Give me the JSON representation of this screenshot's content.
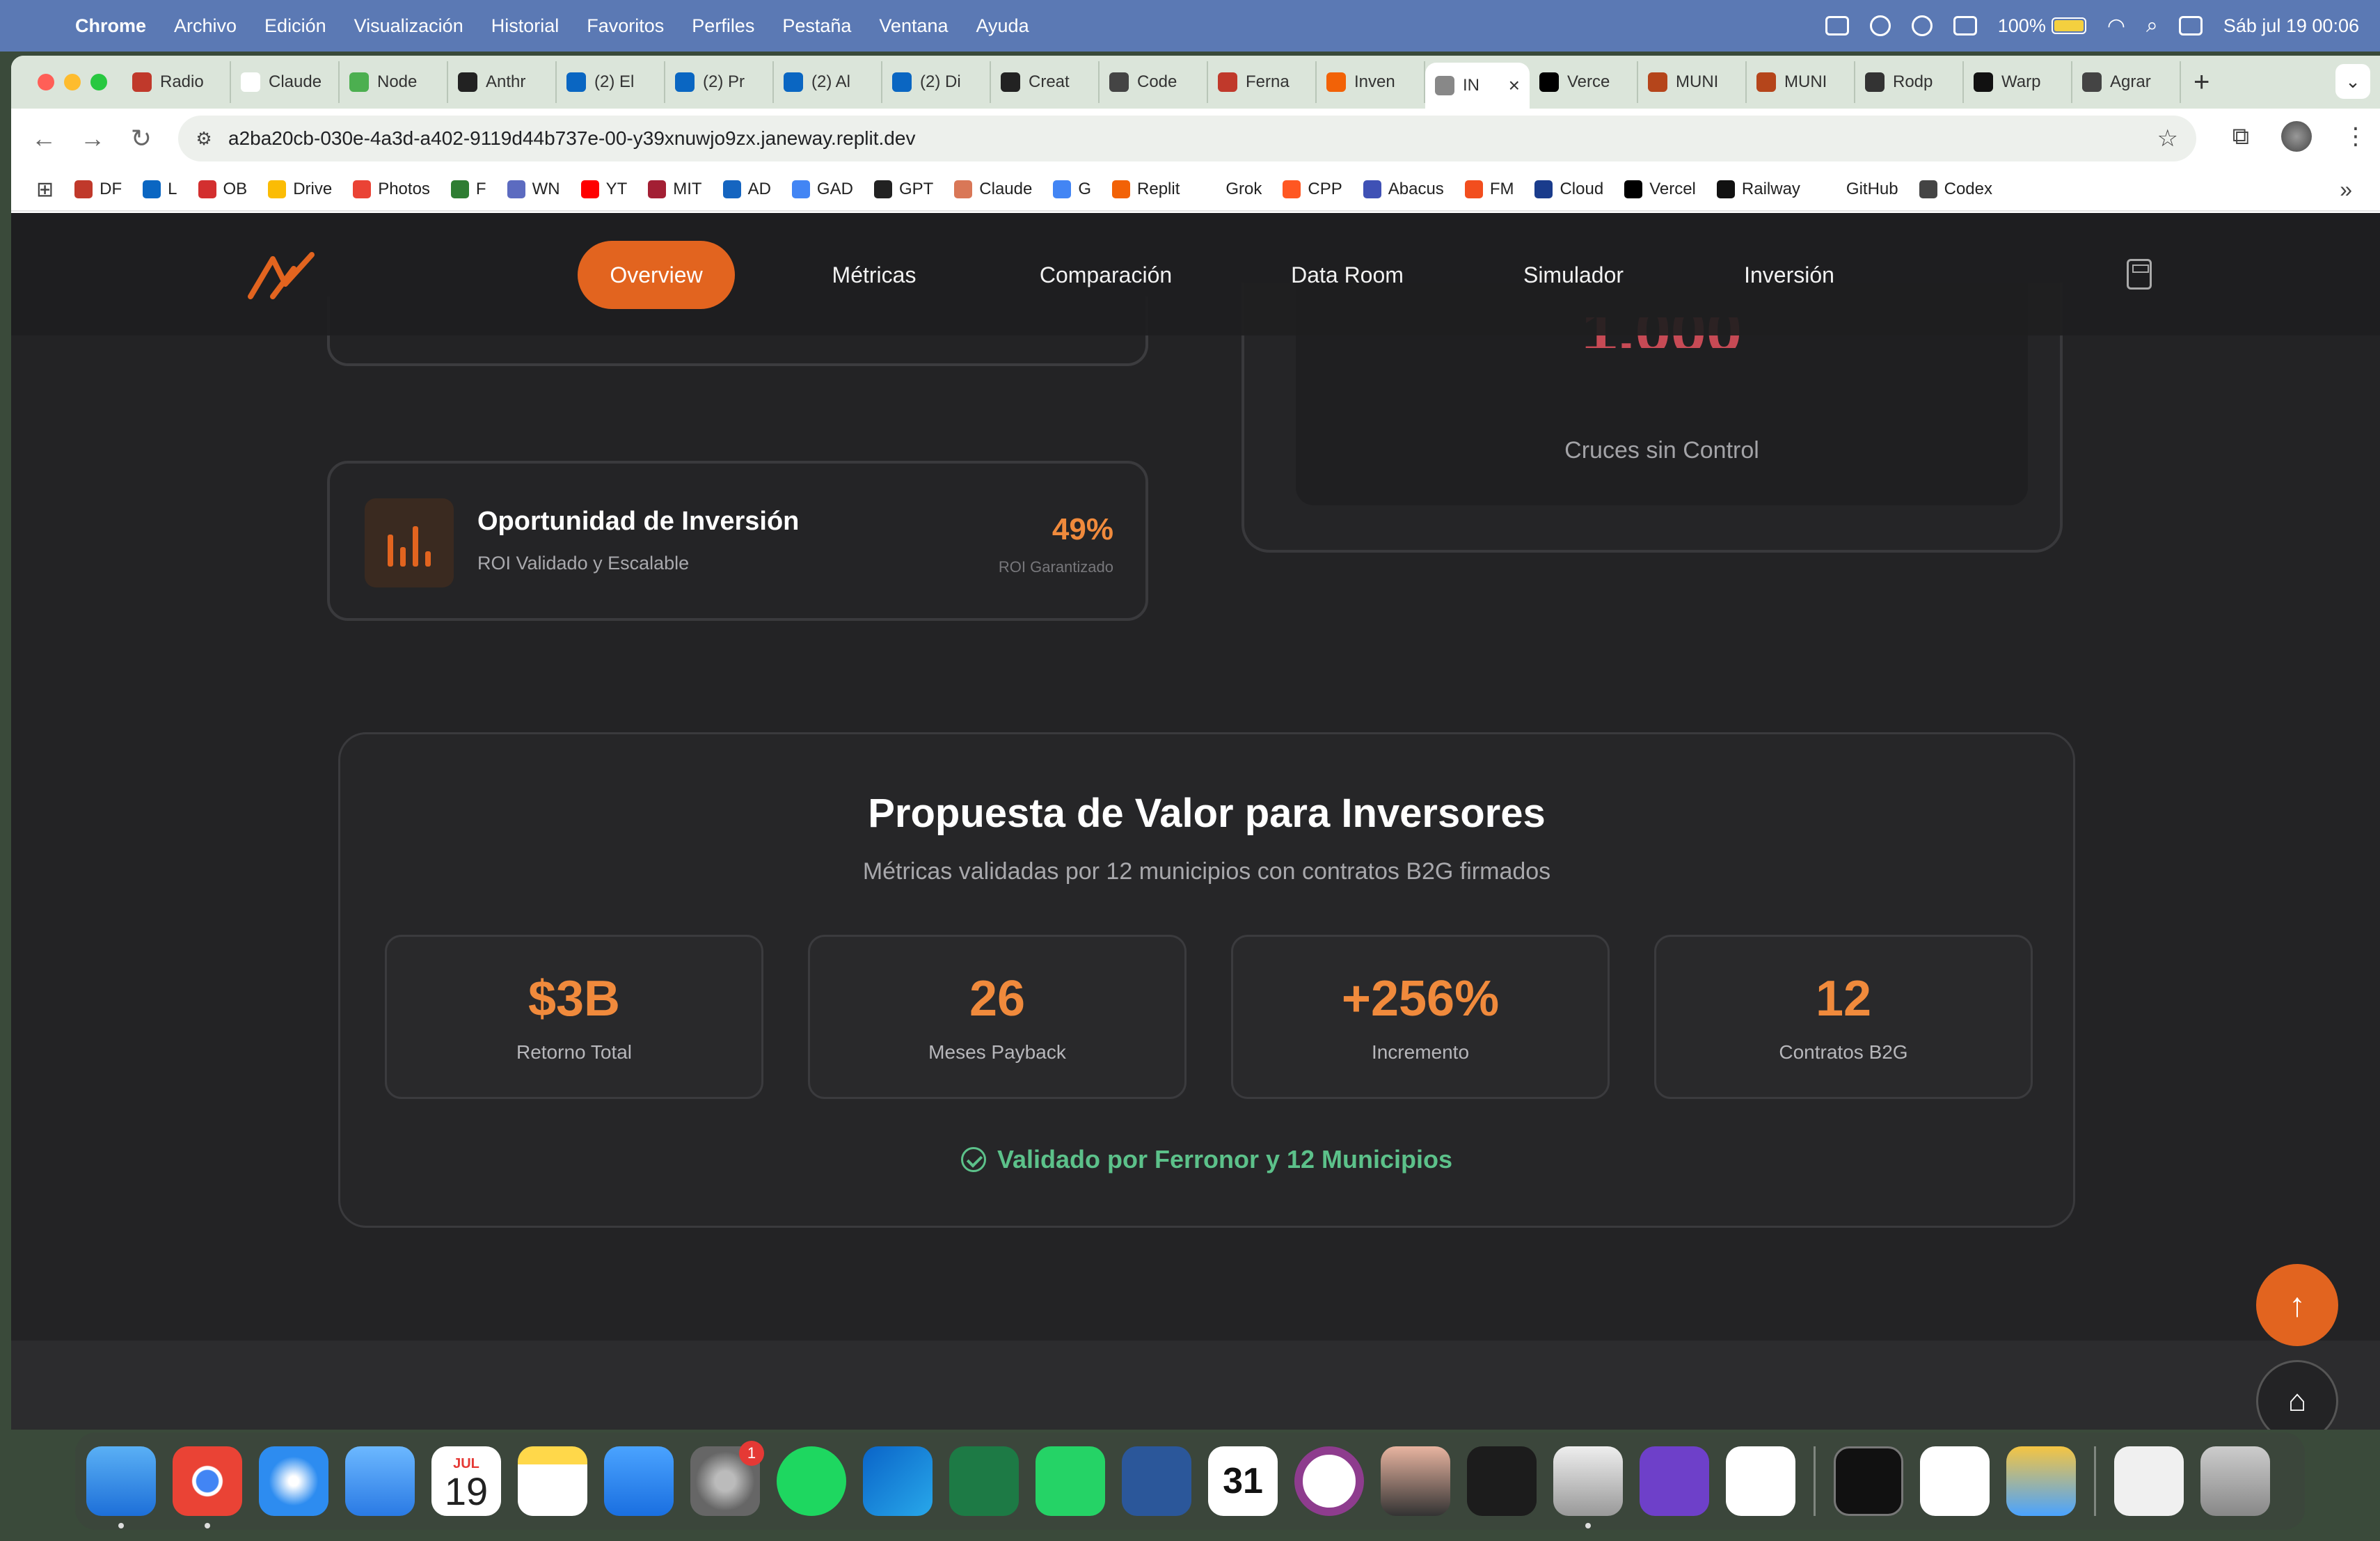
{
  "menubar": {
    "app": "Chrome",
    "items": [
      "Archivo",
      "Edición",
      "Visualización",
      "Historial",
      "Favoritos",
      "Perfiles",
      "Pestaña",
      "Ventana",
      "Ayuda"
    ],
    "battery": "100%",
    "datetime": "Sáb jul 19  00:06"
  },
  "tabs": [
    {
      "label": "Radio",
      "color": "#c0392b"
    },
    {
      "label": "Claude",
      "color": "#ffffff"
    },
    {
      "label": "Node",
      "color": "#4caf50"
    },
    {
      "label": "Anthr",
      "color": "#222222"
    },
    {
      "label": "(2) El",
      "color": "#0a66c2"
    },
    {
      "label": "(2) Pr",
      "color": "#0a66c2"
    },
    {
      "label": "(2) Al",
      "color": "#0a66c2"
    },
    {
      "label": "(2) Di",
      "color": "#0a66c2"
    },
    {
      "label": "Creat",
      "color": "#222222"
    },
    {
      "label": "Code",
      "color": "#444444"
    },
    {
      "label": "Ferna",
      "color": "#c0392b"
    },
    {
      "label": "Inven",
      "color": "#f26207"
    },
    {
      "label": "IN",
      "color": "#888888",
      "active": true
    },
    {
      "label": "Verce",
      "color": "#000000"
    },
    {
      "label": "MUNI",
      "color": "#b5451b"
    },
    {
      "label": "MUNI",
      "color": "#b5451b"
    },
    {
      "label": "Rodp",
      "color": "#333333"
    },
    {
      "label": "Warp",
      "color": "#111111"
    },
    {
      "label": "Agrar",
      "color": "#444444"
    }
  ],
  "address_bar": {
    "url": "a2ba20cb-030e-4a3d-a402-9119d44b737e-00-y39xnuwjo9zx.janeway.replit.dev"
  },
  "bookmarks": [
    {
      "label": "DF",
      "color": "#c0392b"
    },
    {
      "label": "L",
      "color": "#0a66c2"
    },
    {
      "label": "OB",
      "color": "#d32f2f"
    },
    {
      "label": "Drive",
      "color": "#fbbc04"
    },
    {
      "label": "Photos",
      "color": "#ea4335"
    },
    {
      "label": "F",
      "color": "#2e7d32"
    },
    {
      "label": "WN",
      "color": "#5c6bc0"
    },
    {
      "label": "YT",
      "color": "#ff0000"
    },
    {
      "label": "MIT",
      "color": "#a31f34"
    },
    {
      "label": "AD",
      "color": "#1565c0"
    },
    {
      "label": "GAD",
      "color": "#4285f4"
    },
    {
      "label": "GPT",
      "color": "#222222"
    },
    {
      "label": "Claude",
      "color": "#d97757"
    },
    {
      "label": "G",
      "color": "#4285f4"
    },
    {
      "label": "Replit",
      "color": "#f26207"
    },
    {
      "label": "Grok",
      "color": "#ffffff"
    },
    {
      "label": "CPP",
      "color": "#ff5722"
    },
    {
      "label": "Abacus",
      "color": "#3f51b5"
    },
    {
      "label": "FM",
      "color": "#f24e1e"
    },
    {
      "label": "Cloud",
      "color": "#1a3c8c"
    },
    {
      "label": "Vercel",
      "color": "#000000"
    },
    {
      "label": "Railway",
      "color": "#111111"
    },
    {
      "label": "GitHub",
      "color": "#ffffff"
    },
    {
      "label": "Codex",
      "color": "#444444"
    }
  ],
  "site_nav": {
    "items": [
      "Overview",
      "Métricas",
      "Comparación",
      "Data Room",
      "Simulador",
      "Inversión"
    ],
    "active": "Overview",
    "accent": "#e2641f"
  },
  "investment_card": {
    "title": "Oportunidad de Inversión",
    "subtitle": "ROI Validado y Escalable",
    "value": "49%",
    "value_label": "ROI Garantizado"
  },
  "stat_card": {
    "value_partial": "1,000",
    "label": "Cruces sin Control"
  },
  "value_proposition": {
    "title": "Propuesta de Valor para Inversores",
    "subtitle": "Métricas validadas por 12 municipios con contratos B2G firmados",
    "metrics": [
      {
        "value": "$3B",
        "label": "Retorno Total"
      },
      {
        "value": "26",
        "label": "Meses Payback"
      },
      {
        "value": "+256%",
        "label": "Incremento"
      },
      {
        "value": "12",
        "label": "Contratos B2G"
      }
    ],
    "validated_text": "Validado por Ferronor y 12 Municipios",
    "validated_color": "#5cc18a"
  },
  "dock": {
    "calendar_month": "JUL",
    "calendar_day": "19",
    "settings_badge": "1",
    "ical_day": "31"
  }
}
